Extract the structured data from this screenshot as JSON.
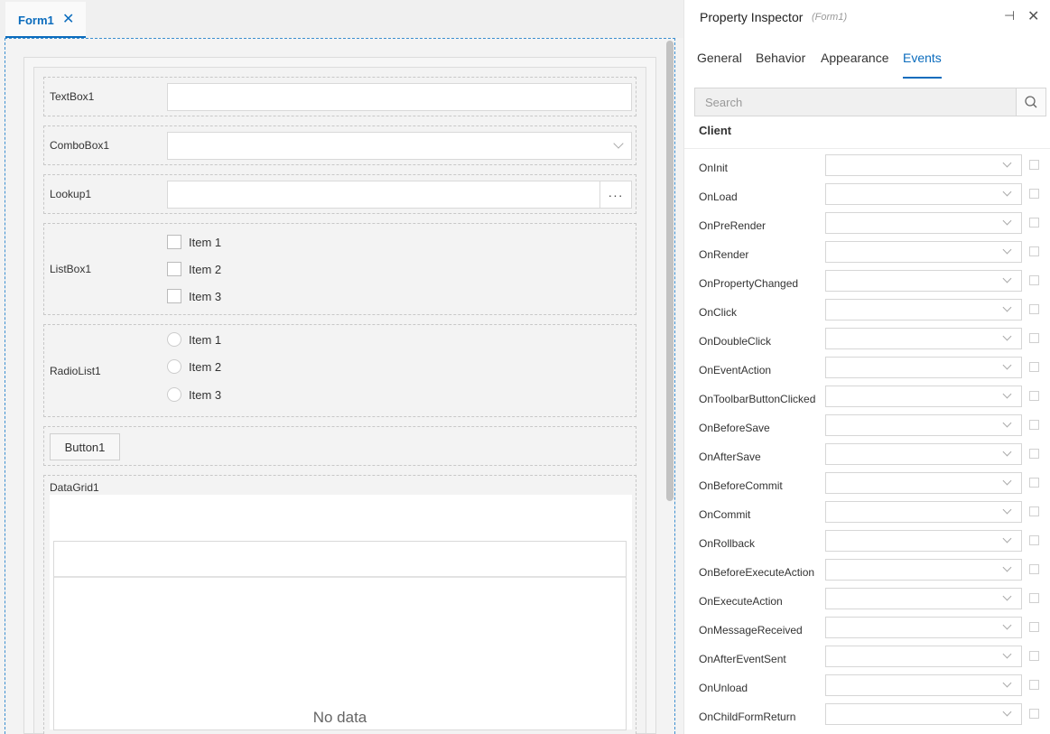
{
  "tab": {
    "label": "Form1",
    "close_icon": "close-icon"
  },
  "form": {
    "textbox": {
      "label": "TextBox1"
    },
    "combobox": {
      "label": "ComboBox1"
    },
    "lookup": {
      "label": "Lookup1",
      "button": "···"
    },
    "listbox": {
      "label": "ListBox1",
      "items": [
        "Item 1",
        "Item 2",
        "Item 3"
      ]
    },
    "radiolist": {
      "label": "RadioList1",
      "items": [
        "Item 1",
        "Item 2",
        "Item 3"
      ]
    },
    "button": {
      "label": "Button1"
    },
    "datagrid": {
      "label": "DataGrid1",
      "empty_text": "No data"
    }
  },
  "inspector": {
    "title": "Property Inspector",
    "subtitle": "(Form1)",
    "tabs": [
      "General",
      "Behavior",
      "Appearance",
      "Events"
    ],
    "active_tab": "Events",
    "search_placeholder": "Search",
    "section": "Client",
    "events": [
      "OnInit",
      "OnLoad",
      "OnPreRender",
      "OnRender",
      "OnPropertyChanged",
      "OnClick",
      "OnDoubleClick",
      "OnEventAction",
      "OnToolbarButtonClicked",
      "OnBeforeSave",
      "OnAfterSave",
      "OnBeforeCommit",
      "OnCommit",
      "OnRollback",
      "OnBeforeExecuteAction",
      "OnExecuteAction",
      "OnMessageReceived",
      "OnAfterEventSent",
      "OnUnload",
      "OnChildFormReturn"
    ]
  },
  "colors": {
    "accent": "#0b6cbd"
  }
}
